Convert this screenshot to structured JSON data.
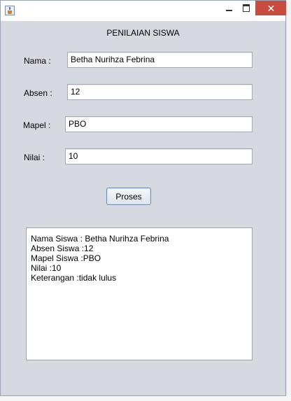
{
  "window": {
    "minimize_label": "—",
    "maximize_label": "□",
    "close_label": "✕"
  },
  "form": {
    "title": "PENILAIAN SISWA",
    "nama_label": "Nama :",
    "nama_value": "Betha Nurihza Febrina",
    "absen_label": "Absen :",
    "absen_value": "12",
    "mapel_label": "Mapel :",
    "mapel_value": "PBO",
    "nilai_label": "Nilai :",
    "nilai_value": "10",
    "proses_label": "Proses"
  },
  "output": {
    "lines": [
      "Nama Siswa : Betha Nurihza Febrina",
      "Absen Siswa :12",
      "Mapel Siswa :PBO",
      "Nilai :10",
      "Keterangan :tidak lulus"
    ]
  },
  "icons": {
    "app": "java-cup-icon",
    "minimize": "minimize-icon",
    "maximize": "maximize-icon",
    "close": "close-icon"
  },
  "colors": {
    "panel": "#d6d9e0",
    "close_button": "#c74b3f",
    "field_bg": "#ffffff"
  }
}
